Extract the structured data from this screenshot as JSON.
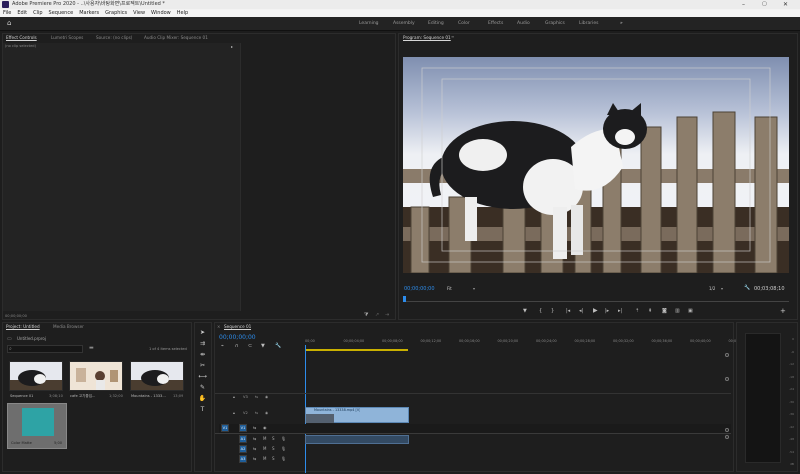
{
  "titlebar": {
    "title": "Adobe Premiere Pro 2020 - ..\\사용자\\바탕화면\\프로젝트\\Untitled *"
  },
  "menu": [
    "File",
    "Edit",
    "Clip",
    "Sequence",
    "Markers",
    "Graphics",
    "View",
    "Window",
    "Help"
  ],
  "workspaces": [
    "Learning",
    "Assembly",
    "Editing",
    "Color",
    "Effects",
    "Audio",
    "Graphics",
    "Libraries"
  ],
  "source_panel": {
    "tabs": [
      "Effect Controls",
      "Lumetri Scopes",
      "Source: (no clips)",
      "Audio Clip Mixer: Sequence 01"
    ],
    "no_clip": "(no clip selected)",
    "timecode": "00;00;00;00"
  },
  "program": {
    "tab": "Program: Sequence 01",
    "timecode": "00;00;00;00",
    "fit": "Fit",
    "quality": "1/2",
    "duration": "00;03;08;10"
  },
  "project": {
    "tabs": [
      "Project: Untitled",
      "Media Browser"
    ],
    "file": "Untitled.prproj",
    "count": "1 of 4 items selected",
    "items": [
      {
        "name": "Sequence 01",
        "duration": "3;08;10"
      },
      {
        "name": "cafe 고기좋입...",
        "duration": "1;32;00"
      },
      {
        "name": "Mountains - 1333...",
        "duration": "13;09"
      },
      {
        "name": "Color Matte",
        "duration": "5;00"
      }
    ]
  },
  "timeline": {
    "tab": "Sequence 01",
    "timecode": "00;00;00;00",
    "ruler": [
      "00;00",
      "00;00;04;00",
      "00;00;08;00",
      "00;00;12;00",
      "00;00;16;00",
      "00;00;20;00",
      "00;00;24;00",
      "00;00;28;00",
      "00;00;32;00",
      "00;00;36;00",
      "00;00;40;00",
      "00;00;44;00"
    ],
    "video_tracks": [
      "V3",
      "V2",
      "V1"
    ],
    "audio_tracks": [
      "A1",
      "A2",
      "A3"
    ],
    "clip_v1": "Mountains - 13338.mp4 [V]"
  },
  "vu_scale": [
    "0",
    "-6",
    "-12",
    "-18",
    "-24",
    "-30",
    "-36",
    "-42",
    "-48",
    "-54",
    "dB"
  ]
}
